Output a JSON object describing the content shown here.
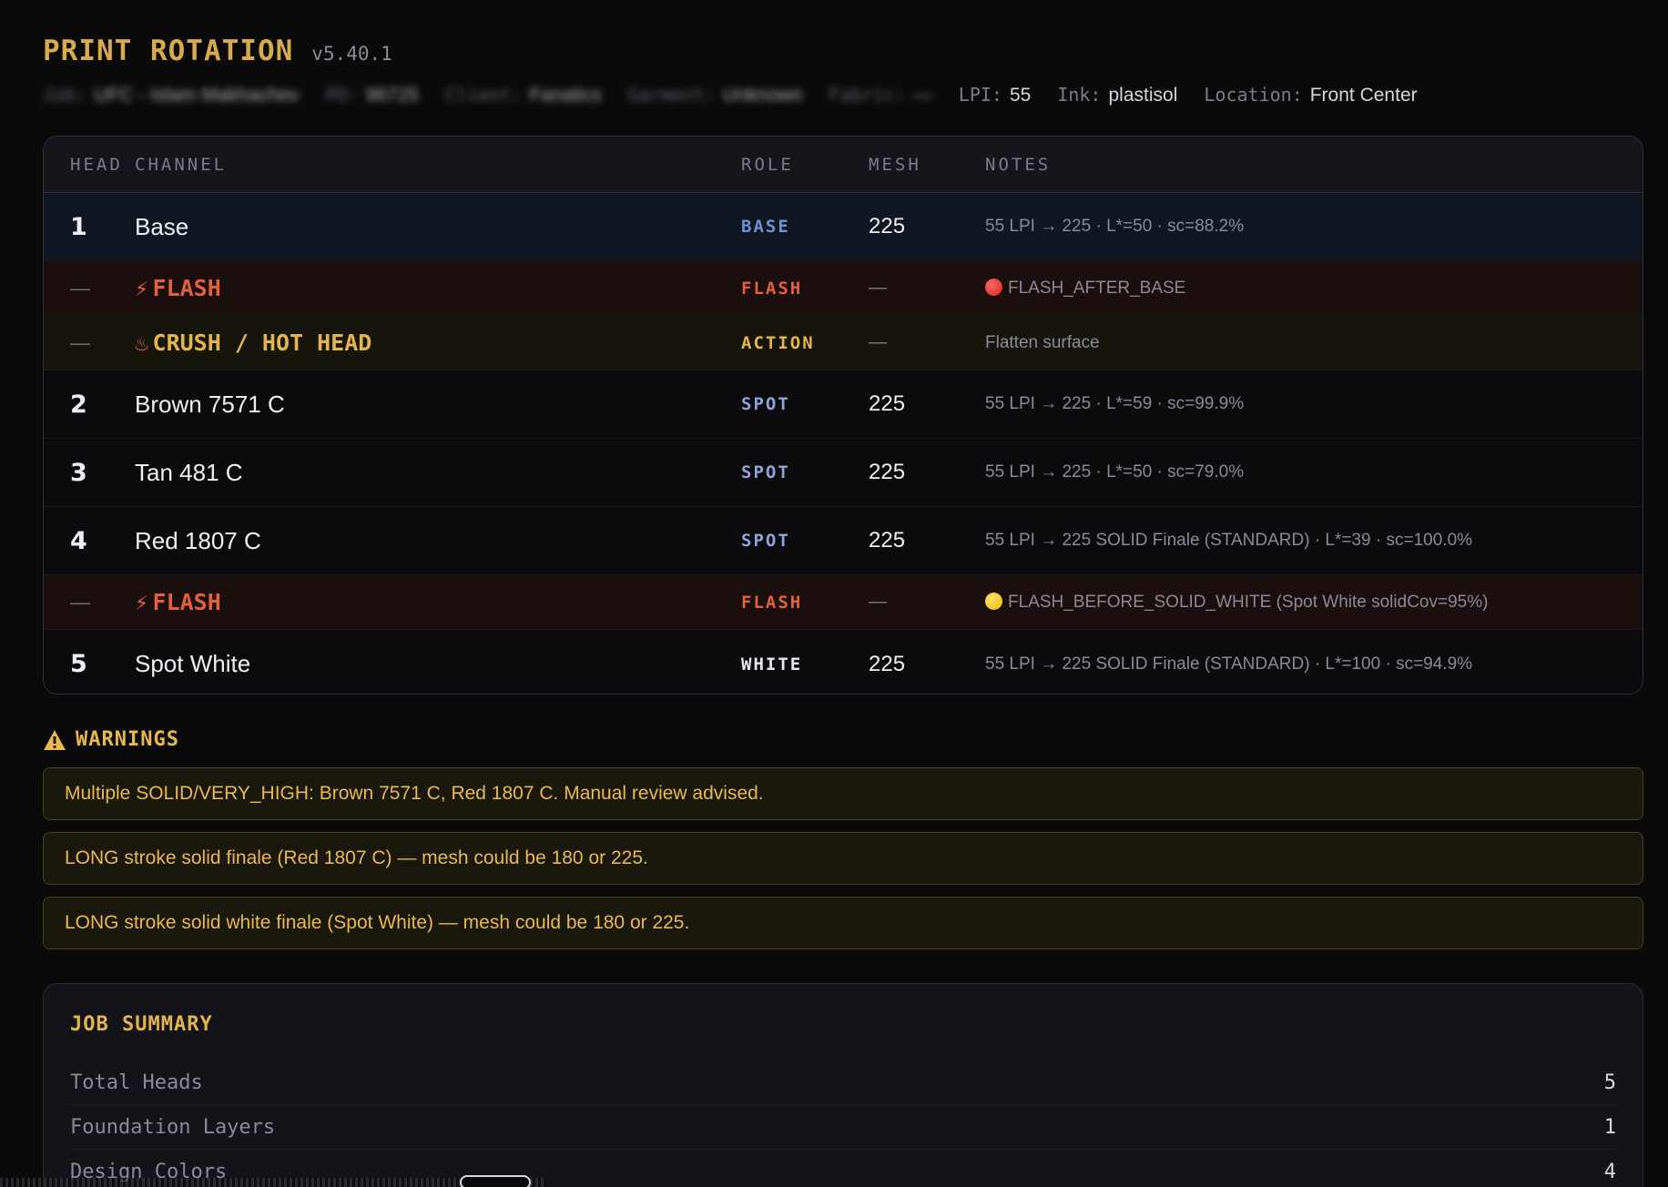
{
  "header": {
    "title": "PRINT ROTATION",
    "version": "v5.40.1"
  },
  "meta": {
    "job_label": "Job:",
    "job_value": "UFC - Islam Makhachev",
    "po_label": "PO:",
    "po_value": "96725",
    "client_label": "Client:",
    "client_value": "Fanatics",
    "garment_label": "Garment:",
    "garment_value": "Unknown",
    "fabric_label": "Fabric:",
    "fabric_value": "—",
    "lpi_label": "LPI:",
    "lpi_value": "55",
    "ink_label": "Ink:",
    "ink_value": "plastisol",
    "location_label": "Location:",
    "location_value": "Front Center"
  },
  "table": {
    "columns": {
      "head": "HEAD",
      "channel": "CHANNEL",
      "role": "ROLE",
      "mesh": "MESH",
      "notes": "NOTES"
    },
    "rows": [
      {
        "head": "1",
        "channel": "Base",
        "role": "BASE",
        "mesh": "225",
        "notes": "55 LPI → 225 · L*=50 · sc=88.2%",
        "role_color": "#6f93cf"
      },
      {
        "head": "—",
        "icon": "lightning-icon",
        "icon_glyph": "⚡",
        "channel": "FLASH",
        "role": "FLASH",
        "mesh": "—",
        "notes": "FLASH_AFTER_BASE",
        "notes_dot": "red-circle-icon",
        "role_color": "#e0603f"
      },
      {
        "head": "—",
        "icon": "hot-springs-icon",
        "icon_glyph": "♨",
        "channel": "CRUSH / HOT HEAD",
        "role": "ACTION",
        "mesh": "—",
        "notes": "Flatten surface",
        "role_color": "#e2b44f"
      },
      {
        "head": "2",
        "channel": "Brown 7571 C",
        "role": "SPOT",
        "mesh": "225",
        "notes": "55 LPI → 225 · L*=59 · sc=99.9%",
        "role_color": "#8fa3d6"
      },
      {
        "head": "3",
        "channel": "Tan 481 C",
        "role": "SPOT",
        "mesh": "225",
        "notes": "55 LPI → 225 · L*=50 · sc=79.0%",
        "role_color": "#8fa3d6"
      },
      {
        "head": "4",
        "channel": "Red 1807 C",
        "role": "SPOT",
        "mesh": "225",
        "notes": "55 LPI → 225 SOLID Finale (STANDARD) · L*=39 · sc=100.0%",
        "role_color": "#8fa3d6"
      },
      {
        "head": "—",
        "icon": "lightning-icon",
        "icon_glyph": "⚡",
        "channel": "FLASH",
        "role": "FLASH",
        "mesh": "—",
        "notes": "FLASH_BEFORE_SOLID_WHITE (Spot White solidCov=95%)",
        "notes_dot": "yellow-circle-icon",
        "role_color": "#e0603f"
      },
      {
        "head": "5",
        "channel": "Spot White",
        "role": "WHITE",
        "mesh": "225",
        "notes": "55 LPI → 225 SOLID Finale (STANDARD) · L*=100 · sc=94.9%",
        "role_color": "#e6e6ee"
      }
    ]
  },
  "warnings": {
    "icon": "warning-triangle-icon",
    "title": "WARNINGS",
    "items": [
      "Multiple SOLID/VERY_HIGH: Brown 7571 C, Red 1807 C. Manual review advised.",
      "LONG stroke solid finale (Red 1807 C) — mesh could be 180 or 225.",
      "LONG stroke solid white finale (Spot White) — mesh could be 180 or 225."
    ]
  },
  "summary": {
    "title": "JOB SUMMARY",
    "rows": [
      {
        "label": "Total Heads",
        "value": "5"
      },
      {
        "label": "Foundation Layers",
        "value": "1"
      },
      {
        "label": "Design Colors",
        "value": "4"
      }
    ]
  },
  "colors": {
    "accent_gold": "#d8aa4e",
    "flash_red": "#e0603f",
    "base_blue": "#6f93cf",
    "spot_blue": "#8fa3d6",
    "warning_text": "#e8b94f",
    "red_dot": "#e0302a",
    "yellow_dot": "#f5c518"
  }
}
